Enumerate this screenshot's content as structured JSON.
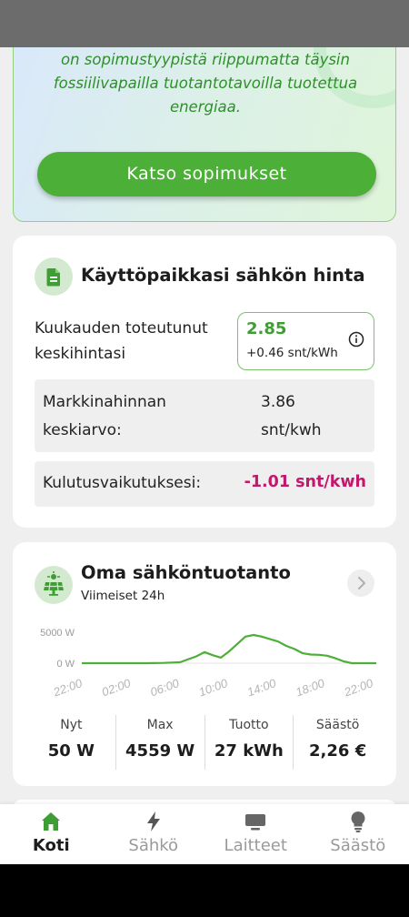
{
  "promo": {
    "text_line1": "on sopimustyypistä riippumatta täysin",
    "text_line2": "fossiilivapailla tuotantotavoilla tuotettua",
    "text_line3": "energiaa.",
    "button_label": "Katso sopimukset"
  },
  "price_card": {
    "title": "Käyttöpaikkasi sähkön hinta",
    "icon": "document-icon",
    "monthly_label_line1": "Kuukauden toteutunut",
    "monthly_label_line2": "keskihintasi",
    "monthly_value": "2.85",
    "monthly_delta": "+0.46 snt/kWh",
    "market_label_line1": "Markkinahinnan",
    "market_label_line2": "keskiarvo:",
    "market_value_line1": "3.86",
    "market_value_line2": "snt/kwh",
    "impact_label": "Kulutusvaikutuksesi:",
    "impact_value": "-1.01 snt/kwh",
    "colors": {
      "accent_green": "#3f9e33",
      "impact_magenta": "#c2186b"
    }
  },
  "production_card": {
    "title": "Oma sähköntuotanto",
    "subtitle": "Viimeiset 24h",
    "icon": "solar-panel-icon",
    "chart_data": {
      "type": "line",
      "y_tick_labels": [
        "5000 W",
        "0 W"
      ],
      "x_tick_labels": [
        "22:00",
        "02:00",
        "06:00",
        "10:00",
        "14:00",
        "18:00",
        "22:00"
      ],
      "ylim": [
        0,
        5000
      ],
      "series": [
        {
          "x": [
            22,
            24,
            26,
            28,
            30,
            32,
            34,
            36,
            37,
            38,
            39,
            40,
            41,
            42,
            43,
            44,
            45,
            46,
            47,
            48,
            49,
            50,
            51,
            52,
            53,
            54,
            55,
            56,
            58
          ],
          "values": [
            0,
            0,
            0,
            0,
            0,
            50,
            150,
            1100,
            1800,
            1300,
            900,
            1900,
            3100,
            4300,
            4560,
            4300,
            3900,
            3500,
            2800,
            2300,
            1600,
            1400,
            1350,
            1200,
            800,
            300,
            0,
            0,
            0
          ],
          "color": "#4caf38"
        }
      ]
    },
    "stats": [
      {
        "label": "Nyt",
        "value": "50 W"
      },
      {
        "label": "Max",
        "value": "4559 W"
      },
      {
        "label": "Tuotto",
        "value": "27 kWh"
      },
      {
        "label": "Säästö",
        "value": "2,26 €"
      }
    ]
  },
  "nav": {
    "items": [
      {
        "label": "Koti",
        "icon": "home-icon",
        "active": true
      },
      {
        "label": "Sähkö",
        "icon": "lightning-icon",
        "active": false
      },
      {
        "label": "Laitteet",
        "icon": "monitor-icon",
        "active": false
      },
      {
        "label": "Säästö",
        "icon": "lightbulb-icon",
        "active": false
      }
    ]
  }
}
